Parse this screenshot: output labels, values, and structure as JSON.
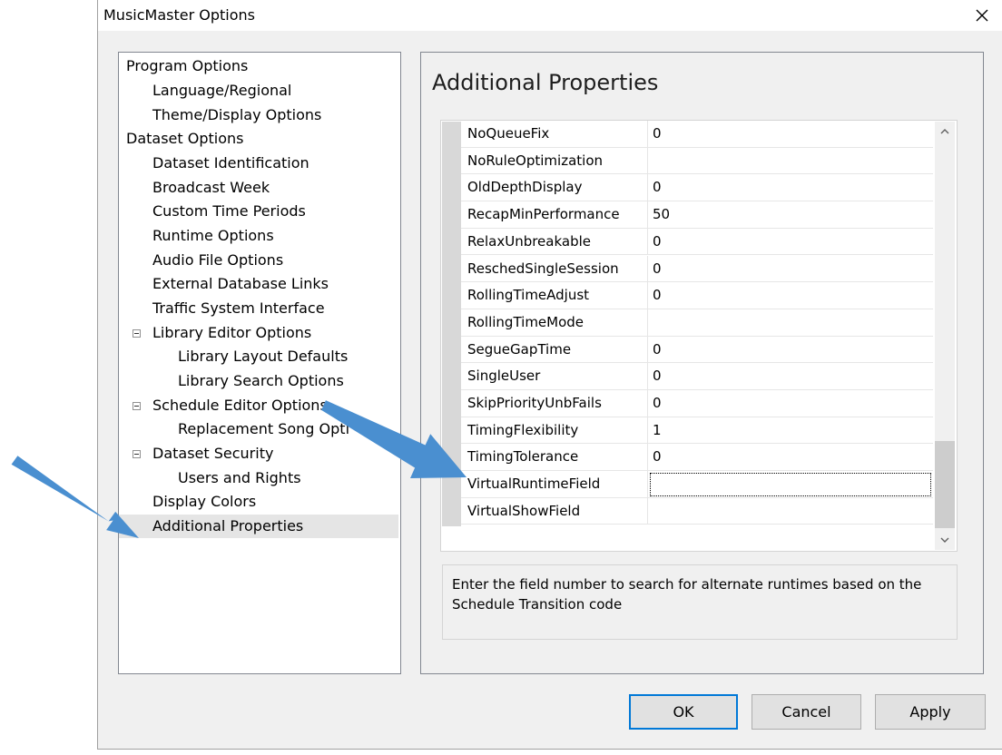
{
  "window": {
    "title": "MusicMaster Options",
    "close_glyph": "✕"
  },
  "tree": {
    "items": [
      {
        "label": "Program Options"
      },
      {
        "label": "Language/Regional"
      },
      {
        "label": "Theme/Display Options"
      },
      {
        "label": "Dataset Options"
      },
      {
        "label": "Dataset Identification"
      },
      {
        "label": "Broadcast Week"
      },
      {
        "label": "Custom Time Periods"
      },
      {
        "label": "Runtime Options"
      },
      {
        "label": "Audio File Options"
      },
      {
        "label": "External Database Links"
      },
      {
        "label": "Traffic System Interface"
      },
      {
        "label": "Library Editor Options"
      },
      {
        "label": "Library Layout Defaults"
      },
      {
        "label": "Library Search Options"
      },
      {
        "label": "Schedule Editor Options"
      },
      {
        "label": "Replacement Song Opti"
      },
      {
        "label": "Dataset Security"
      },
      {
        "label": "Users and Rights"
      },
      {
        "label": "Display Colors"
      },
      {
        "label": "Additional Properties"
      }
    ],
    "selected": "Additional Properties"
  },
  "panel": {
    "heading": "Additional Properties",
    "properties": [
      {
        "name": "NoQueueFix",
        "value": "0"
      },
      {
        "name": "NoRuleOptimization",
        "value": ""
      },
      {
        "name": "OldDepthDisplay",
        "value": "0"
      },
      {
        "name": "RecapMinPerformance",
        "value": "50"
      },
      {
        "name": "RelaxUnbreakable",
        "value": "0"
      },
      {
        "name": "ReschedSingleSession",
        "value": "0"
      },
      {
        "name": "RollingTimeAdjust",
        "value": "0"
      },
      {
        "name": "RollingTimeMode",
        "value": ""
      },
      {
        "name": "SegueGapTime",
        "value": "0"
      },
      {
        "name": "SingleUser",
        "value": "0"
      },
      {
        "name": "SkipPriorityUnbFails",
        "value": "0"
      },
      {
        "name": "TimingFlexibility",
        "value": "1"
      },
      {
        "name": "TimingTolerance",
        "value": "0"
      },
      {
        "name": "VirtualRuntimeField",
        "value": ""
      },
      {
        "name": "VirtualShowField",
        "value": ""
      }
    ],
    "selected_property": "VirtualRuntimeField",
    "description": "Enter the field number to search for alternate runtimes based on the Schedule Transition code"
  },
  "buttons": {
    "ok": "OK",
    "cancel": "Cancel",
    "apply": "Apply"
  },
  "colors": {
    "annotation_arrow": "#4a8fd0",
    "ok_focus_border": "#0078d7",
    "selected_item_bg": "#e5e5e5"
  }
}
